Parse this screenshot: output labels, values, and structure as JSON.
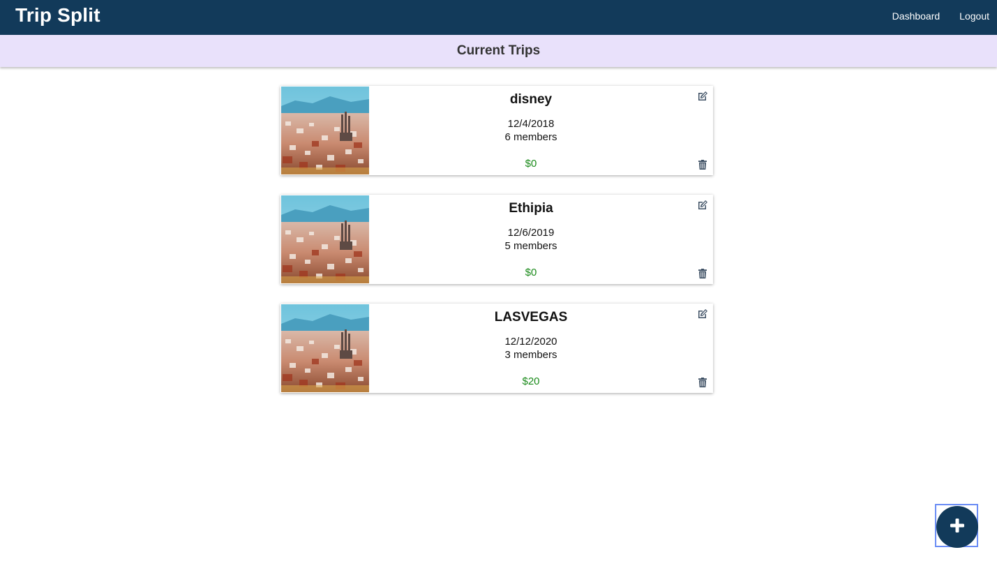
{
  "navbar": {
    "brand": "Trip Split",
    "links": [
      {
        "label": "Dashboard"
      },
      {
        "label": "Logout"
      }
    ]
  },
  "page": {
    "title": "Current Trips"
  },
  "trips": [
    {
      "name": "disney",
      "date": "12/4/2018",
      "members": "6 members",
      "total": "$0"
    },
    {
      "name": "Ethipia",
      "date": "12/6/2019",
      "members": "5 members",
      "total": "$0"
    },
    {
      "name": "LASVEGAS",
      "date": "12/12/2020",
      "members": "3 members",
      "total": "$20"
    }
  ],
  "icons": {
    "edit": "edit-icon",
    "delete": "trash-icon",
    "add": "plus-icon"
  },
  "colors": {
    "navbar": "#123a5a",
    "subheader": "#e9e1fb",
    "total_text": "#1a8a1a",
    "fab": "#123a5a",
    "fab_focus_ring": "#6a8cf5"
  }
}
